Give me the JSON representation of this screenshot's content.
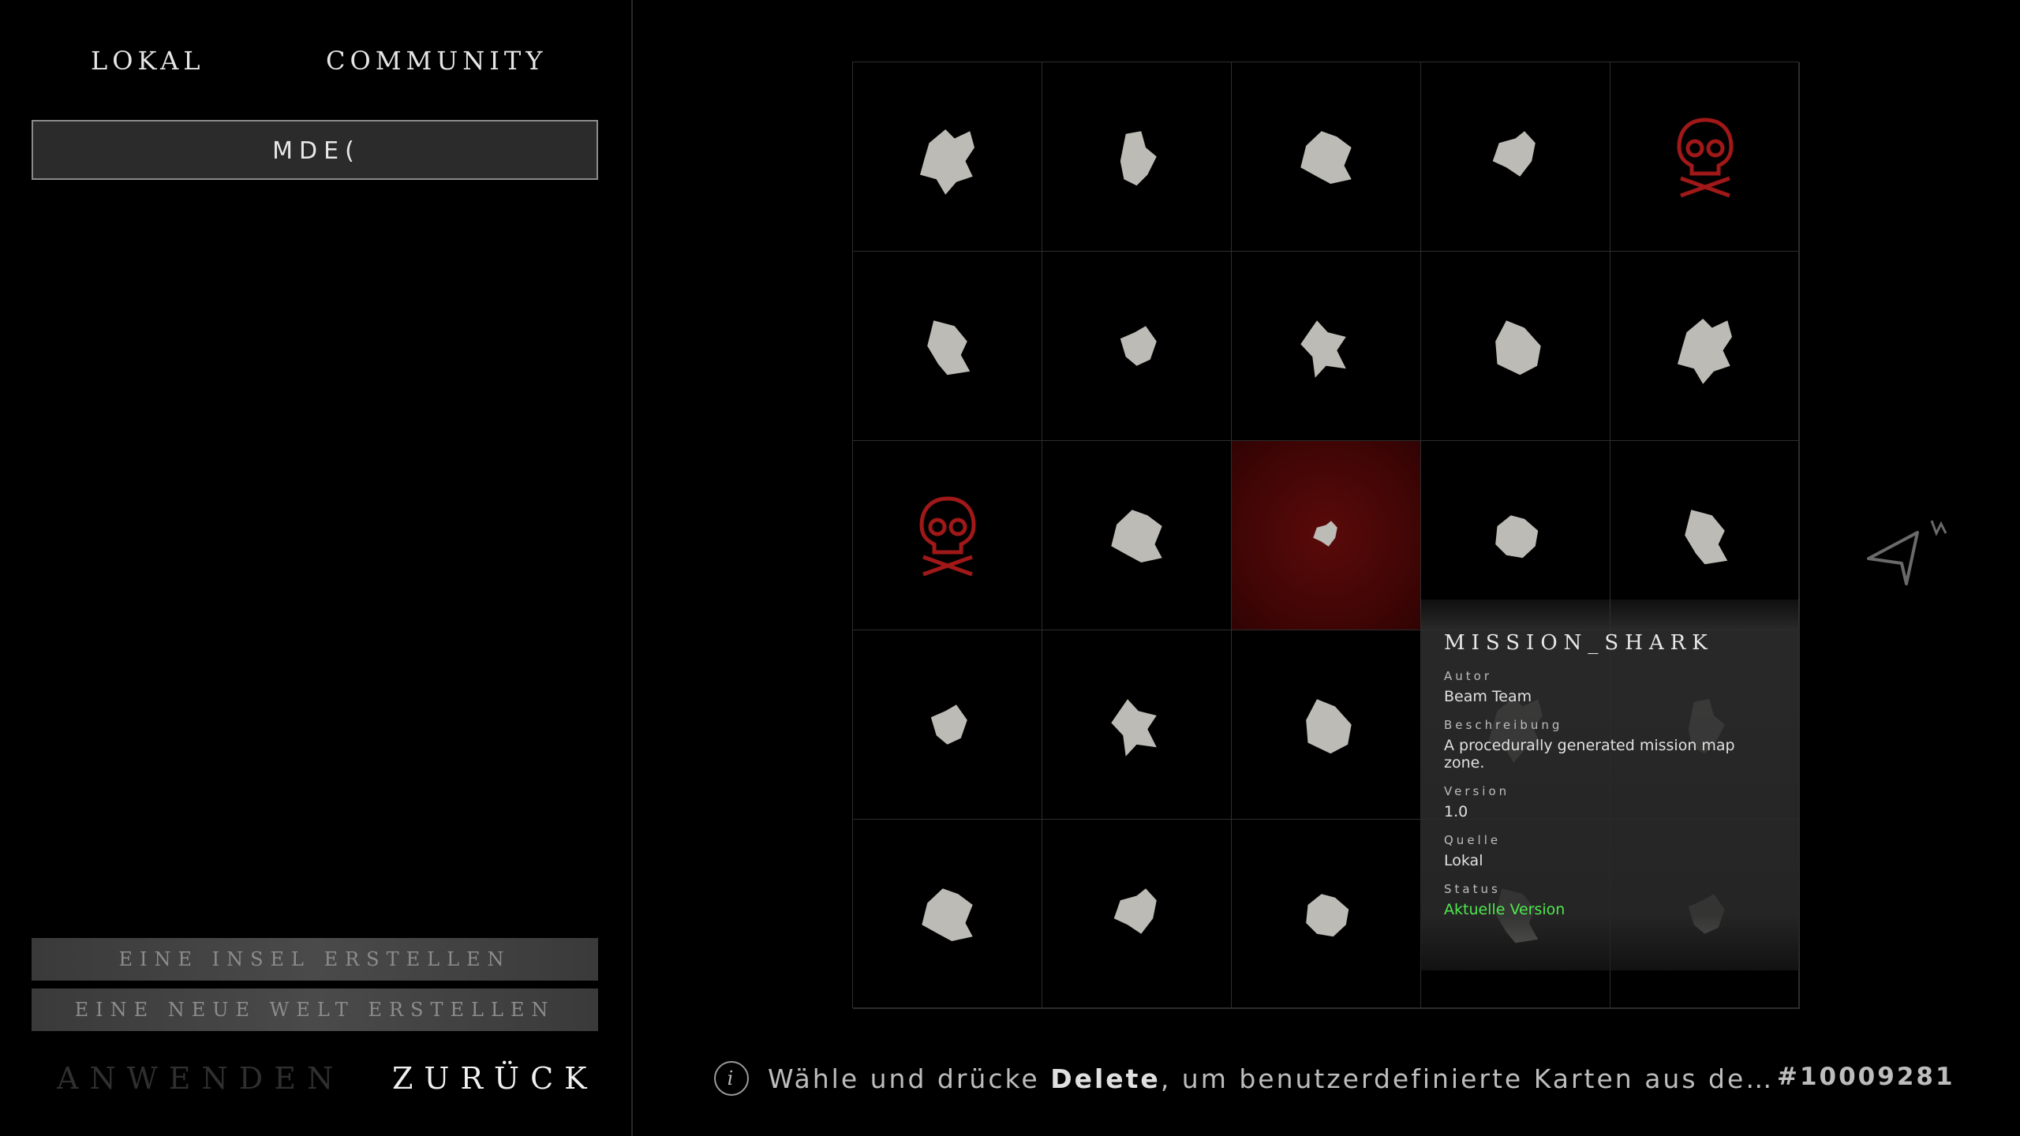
{
  "tabs": {
    "local": "LOKAL",
    "community": "COMMUNITY"
  },
  "search": {
    "value": "MDE("
  },
  "actions": {
    "create_island": "EINE INSEL ERSTELLEN",
    "create_world": "EINE NEUE WELT ERSTELLEN",
    "apply": "ANWENDEN",
    "back": "ZURÜCK"
  },
  "grid": {
    "rows": 5,
    "cols": 5,
    "selected_index": 12,
    "cells": [
      {
        "kind": "island"
      },
      {
        "kind": "island"
      },
      {
        "kind": "island"
      },
      {
        "kind": "island"
      },
      {
        "kind": "skull"
      },
      {
        "kind": "island"
      },
      {
        "kind": "island"
      },
      {
        "kind": "island"
      },
      {
        "kind": "island"
      },
      {
        "kind": "island"
      },
      {
        "kind": "skull"
      },
      {
        "kind": "island"
      },
      {
        "kind": "island"
      },
      {
        "kind": "island"
      },
      {
        "kind": "island"
      },
      {
        "kind": "island"
      },
      {
        "kind": "island"
      },
      {
        "kind": "island"
      },
      {
        "kind": "island"
      },
      {
        "kind": "island"
      },
      {
        "kind": "island"
      },
      {
        "kind": "island"
      },
      {
        "kind": "island"
      },
      {
        "kind": "island"
      },
      {
        "kind": "island"
      }
    ]
  },
  "tooltip": {
    "title": "MISSION_SHARK",
    "author_label": "Autor",
    "author": "Beam Team",
    "description_label": "Beschreibung",
    "description": "A procedurally generated mission map zone.",
    "version_label": "Version",
    "version": "1.0",
    "source_label": "Quelle",
    "source": "Lokal",
    "status_label": "Status",
    "status": "Aktuelle Version",
    "status_color": "#4ee84e"
  },
  "hint": {
    "info_glyph": "i",
    "prefix": "Wähle und drücke ",
    "key": "Delete",
    "suffix": ", um benutzerdefinierte Karten aus de…"
  },
  "map_id": "#10009281",
  "colors": {
    "accent_red": "#a01818",
    "selected_bg": "#4a0808",
    "island": "#bdbbb5"
  }
}
